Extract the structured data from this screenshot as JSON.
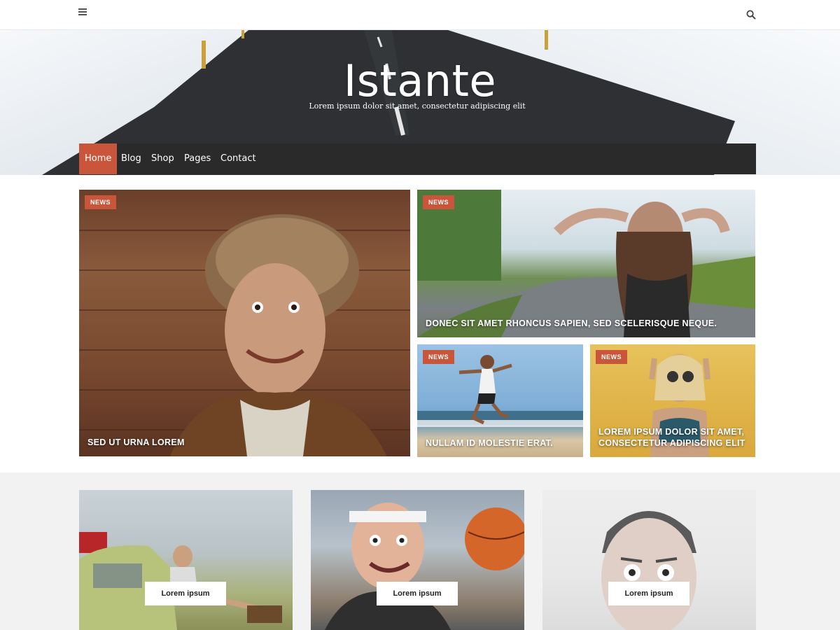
{
  "site": {
    "title": "Istante",
    "tagline": "Lorem ipsum dolor sit amet, consectetur adipiscing elit"
  },
  "topbar": {
    "menu_icon": "hamburger-menu-icon",
    "search_icon": "search-icon"
  },
  "nav": {
    "items": [
      {
        "label": "Home",
        "active": true
      },
      {
        "label": "Blog",
        "active": false
      },
      {
        "label": "Shop",
        "active": false
      },
      {
        "label": "Pages",
        "active": false
      },
      {
        "label": "Contact",
        "active": false
      }
    ]
  },
  "featured": [
    {
      "badge": "NEWS",
      "title": "SED UT URNA LOREM"
    },
    {
      "badge": "NEWS",
      "title": "DONEC SIT AMET RHONCUS SAPIEN, SED SCELERISQUE NEQUE."
    },
    {
      "badge": "NEWS",
      "title": "NULLAM ID MOLESTIE ERAT."
    },
    {
      "badge": "NEWS",
      "title": "LOREM IPSUM DOLOR SIT AMET, CONSECTETUR ADIPISCING ELIT"
    }
  ],
  "cards": [
    {
      "label": "Lorem ipsum"
    },
    {
      "label": "Lorem ipsum"
    },
    {
      "label": "Lorem ipsum"
    }
  ],
  "colors": {
    "accent": "#c9553a",
    "navbar": "#2a2a2a",
    "band": "#f2f2f2"
  }
}
